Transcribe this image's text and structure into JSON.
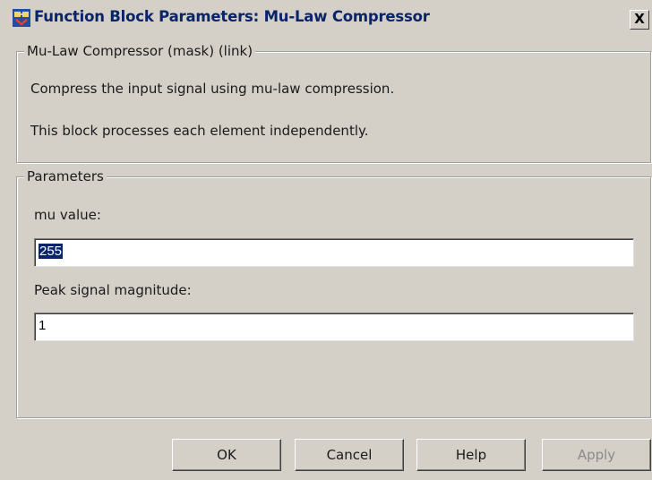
{
  "window": {
    "title": "Function Block Parameters: Mu-Law Compressor",
    "icon": "simulink-block-icon",
    "close_label": "X"
  },
  "description_group": {
    "legend": "Mu-Law Compressor (mask) (link)",
    "line1": "Compress the input signal using mu-law compression.",
    "line2": "This block processes each element independently."
  },
  "parameters_group": {
    "legend": "Parameters",
    "mu_label": "mu value:",
    "mu_value": "255",
    "peak_label": "Peak signal magnitude:",
    "peak_value": "1"
  },
  "buttons": {
    "ok": "OK",
    "cancel": "Cancel",
    "help": "Help",
    "apply": "Apply"
  },
  "colors": {
    "background": "#d4d0c8",
    "title_text": "#0a246a",
    "selection": "#0a246a"
  }
}
